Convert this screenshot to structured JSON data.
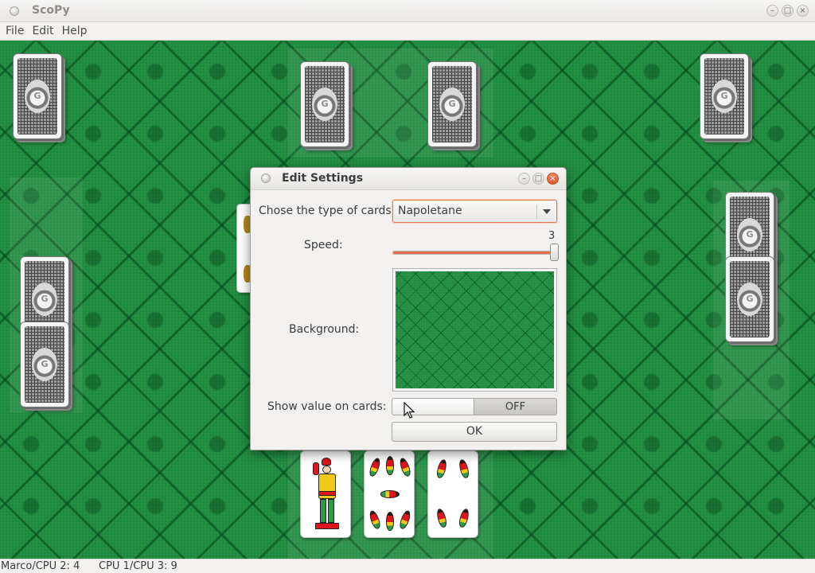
{
  "window": {
    "title": "ScoPy"
  },
  "menu": {
    "items": [
      "File",
      "Edit",
      "Help"
    ]
  },
  "dialog": {
    "title": "Edit Settings",
    "card_type_label": "Chose the type of cards:",
    "card_type_value": "Napoletane",
    "speed_label": "Speed:",
    "speed_value": "3",
    "speed_fraction": 1.0,
    "background_label": "Background:",
    "show_value_label": "Show value on cards:",
    "show_value_state": "OFF",
    "ok_label": "OK"
  },
  "status": {
    "left": "Marco/CPU 2: 4",
    "right": "CPU 1/CPU 3: 9"
  },
  "colors": {
    "felt": "#1e8a3e",
    "accent": "#e8704a"
  }
}
